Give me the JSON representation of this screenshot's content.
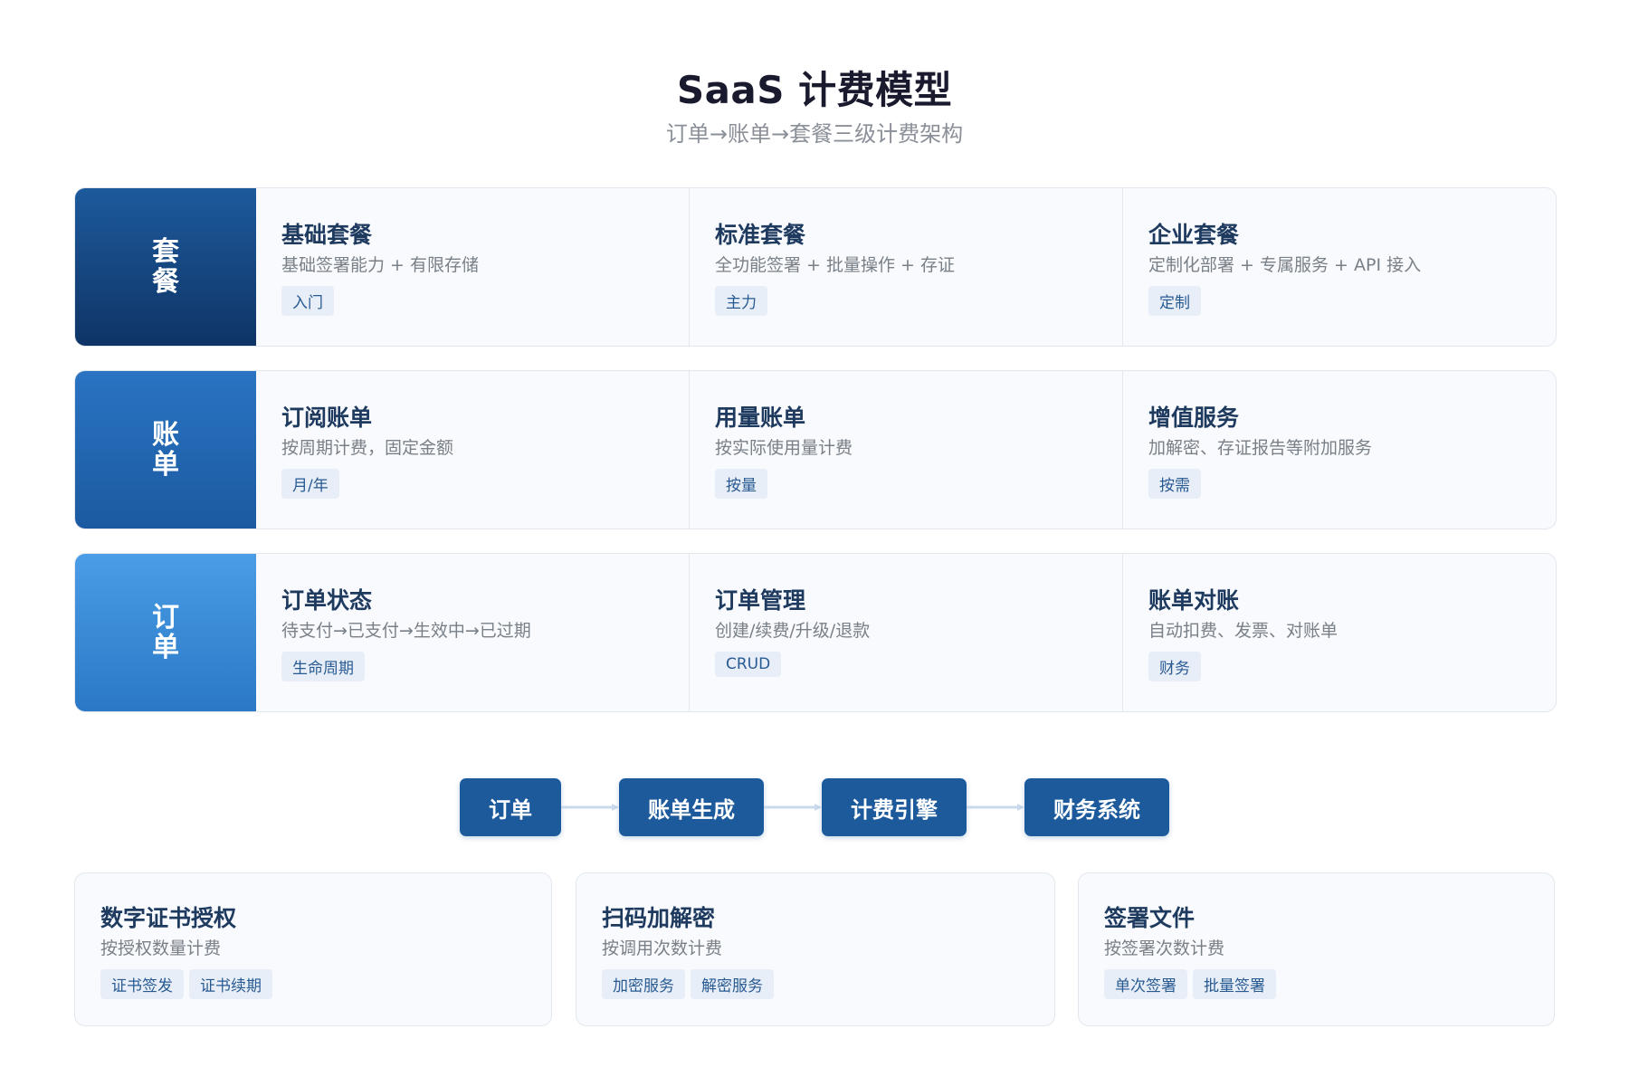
{
  "header": {
    "title": "SaaS 计费模型",
    "subtitle": "订单→账单→套餐三级计费架构"
  },
  "colors": {
    "tier_package": [
      "#1d5a9c",
      "#0f3466"
    ],
    "tier_bill": [
      "#2a74c3",
      "#1b5aa0"
    ],
    "tier_order": [
      "#4a9de6",
      "#2a78c6"
    ],
    "flow_node": "#1d5a9c",
    "tag_bg": "#e8eef7",
    "tag_text": "#285a92"
  },
  "tiers": [
    {
      "label": "套餐",
      "chars": [
        "套",
        "餐"
      ],
      "cells": [
        {
          "title": "基础套餐",
          "desc": "基础签署能力 + 有限存储",
          "tag": "入门"
        },
        {
          "title": "标准套餐",
          "desc": "全功能签署 + 批量操作 + 存证",
          "tag": "主力"
        },
        {
          "title": "企业套餐",
          "desc": "定制化部署 + 专属服务 + API 接入",
          "tag": "定制"
        }
      ]
    },
    {
      "label": "账单",
      "chars": [
        "账",
        "单"
      ],
      "cells": [
        {
          "title": "订阅账单",
          "desc": "按周期计费，固定金额",
          "tag": "月/年"
        },
        {
          "title": "用量账单",
          "desc": "按实际使用量计费",
          "tag": "按量"
        },
        {
          "title": "增值服务",
          "desc": "加解密、存证报告等附加服务",
          "tag": "按需"
        }
      ]
    },
    {
      "label": "订单",
      "chars": [
        "订",
        "单"
      ],
      "cells": [
        {
          "title": "订单状态",
          "desc": "待支付→已支付→生效中→已过期",
          "tag": "生命周期"
        },
        {
          "title": "订单管理",
          "desc": "创建/续费/升级/退款",
          "tag": "CRUD"
        },
        {
          "title": "账单对账",
          "desc": "自动扣费、发票、对账单",
          "tag": "财务"
        }
      ]
    }
  ],
  "flow": [
    "订单",
    "账单生成",
    "计费引擎",
    "财务系统"
  ],
  "cards": [
    {
      "title": "数字证书授权",
      "desc": "按授权数量计费",
      "tags": [
        "证书签发",
        "证书续期"
      ]
    },
    {
      "title": "扫码加解密",
      "desc": "按调用次数计费",
      "tags": [
        "加密服务",
        "解密服务"
      ]
    },
    {
      "title": "签署文件",
      "desc": "按签署次数计费",
      "tags": [
        "单次签署",
        "批量签署"
      ]
    }
  ]
}
